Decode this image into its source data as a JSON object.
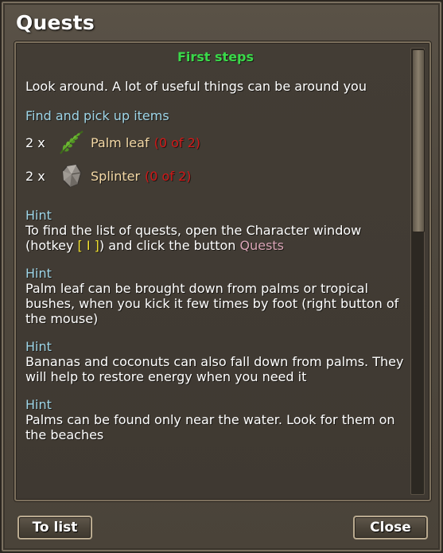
{
  "window": {
    "title": "Quests"
  },
  "quest": {
    "name": "First steps",
    "description": "Look around. A lot of useful things can be around you",
    "objective_title": "Find and pick up items",
    "requirements": [
      {
        "count": "2 x",
        "name": "Palm leaf",
        "progress": "(0 of 2)",
        "icon": "palm-leaf-icon"
      },
      {
        "count": "2 x",
        "name": "Splinter",
        "progress": "(0 of 2)",
        "icon": "splinter-icon"
      }
    ],
    "hints": [
      {
        "title": "Hint",
        "text_before": "To find the list of quests, open the Character window (hotkey ",
        "hotkey": "[ I ]",
        "text_middle": ") and click the button ",
        "link": "Quests"
      },
      {
        "title": "Hint",
        "text": "Palm leaf can be brought down from palms or tropical bushes, when you kick it few times by foot (right button of the mouse)"
      },
      {
        "title": "Hint",
        "text": "Bananas and coconuts can also fall down from palms. They will help to restore energy when you need it"
      },
      {
        "title": "Hint",
        "text": "Palms can be found only near the water. Look for them on the beaches"
      }
    ]
  },
  "buttons": {
    "to_list": "To list",
    "close": "Close"
  },
  "colors": {
    "quest_name": "#3ad94a",
    "section_title": "#9fd6e8",
    "item_name": "#f4d9a6",
    "progress": "#d11818",
    "hotkey": "#f0e030",
    "link": "#d9a4b6"
  },
  "scroll": {
    "thumb_fraction": 0.4,
    "position": 0
  }
}
